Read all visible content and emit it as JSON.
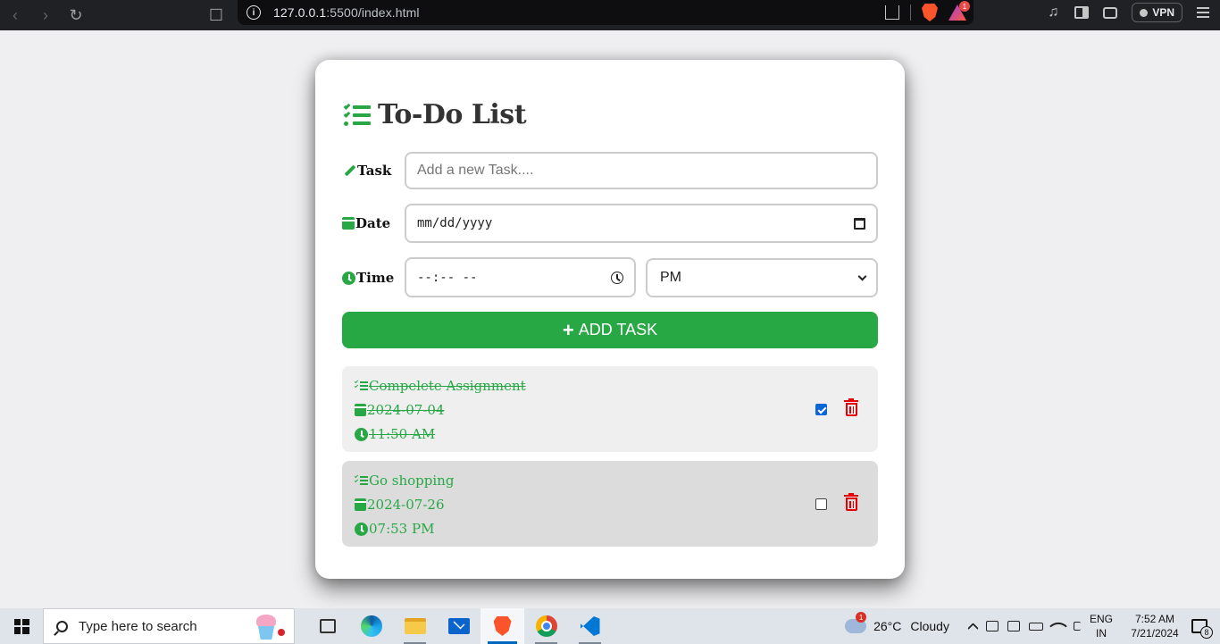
{
  "browser": {
    "url_host": "127.0.0.1",
    "url_rest": ":5500/index.html",
    "rewards_badge": "1",
    "vpn_label": "VPN"
  },
  "app": {
    "title": "To-Do List",
    "task_label": "Task",
    "task_placeholder": "Add a new Task....",
    "date_label": "Date",
    "date_value": "mm/dd/yyyy",
    "time_label": "Time",
    "time_value": "--:-- --",
    "ampm_selected": "PM",
    "add_button": "ADD TASK"
  },
  "tasks": [
    {
      "name": "Compelete Assignment",
      "date": "2024-07-04",
      "time": "11:50 AM",
      "completed": true,
      "bg": "#efefef"
    },
    {
      "name": "Go shopping",
      "date": "2024-07-26",
      "time": "07:53 PM",
      "completed": false,
      "bg": "#dcdcdc"
    }
  ],
  "colors": {
    "accent": "#28a745",
    "delete": "#e60000",
    "page_bg": "#efeff1"
  },
  "taskbar": {
    "search_placeholder": "Type here to search",
    "weather_temp": "26°C",
    "weather_desc": "Cloudy",
    "weather_badge": "1",
    "lang_top": "ENG",
    "lang_bottom": "IN",
    "time": "7:52 AM",
    "date": "7/21/2024",
    "notif_count": "8"
  }
}
